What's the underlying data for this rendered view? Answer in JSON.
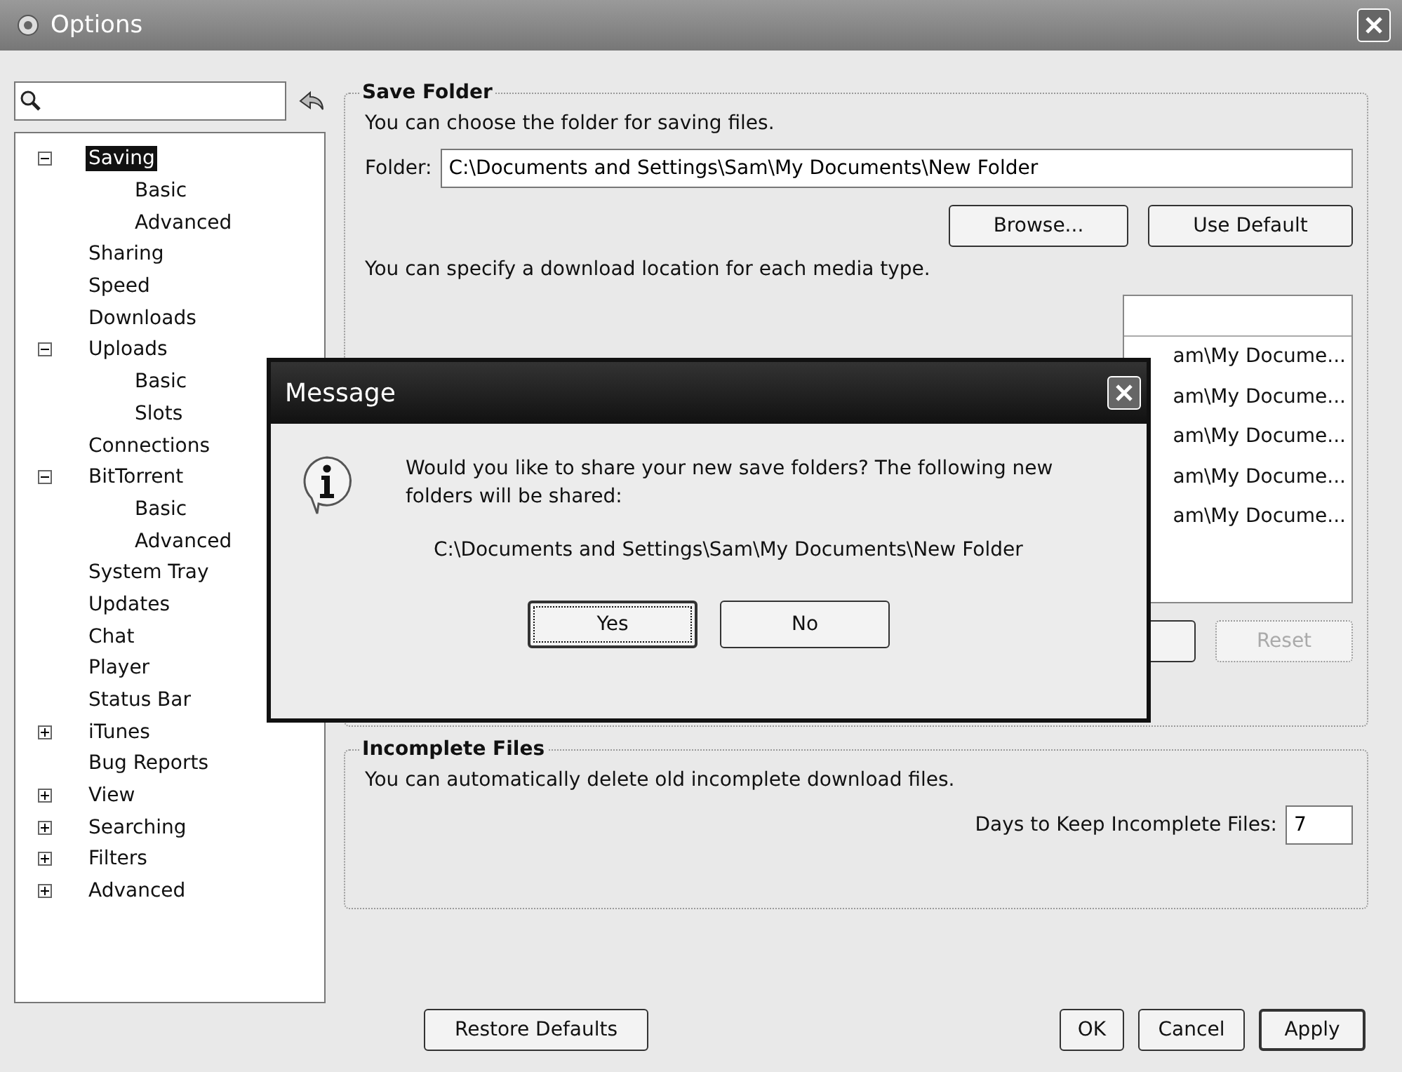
{
  "window": {
    "title": "Options"
  },
  "tree": [
    {
      "label": "Saving",
      "selected": true,
      "expanded": true,
      "children": [
        {
          "label": "Basic",
          "selected": false
        },
        {
          "label": "Advanced",
          "selected": false
        }
      ]
    },
    {
      "label": "Sharing",
      "selected": false
    },
    {
      "label": "Speed",
      "selected": false
    },
    {
      "label": "Downloads",
      "selected": false
    },
    {
      "label": "Uploads",
      "selected": false,
      "expanded": true,
      "children": [
        {
          "label": "Basic",
          "selected": false
        },
        {
          "label": "Slots",
          "selected": false
        }
      ]
    },
    {
      "label": "Connections",
      "selected": false
    },
    {
      "label": "BitTorrent",
      "selected": false,
      "expanded": true,
      "children": [
        {
          "label": "Basic",
          "selected": false
        },
        {
          "label": "Advanced",
          "selected": false
        }
      ]
    },
    {
      "label": "System Tray",
      "selected": false
    },
    {
      "label": "Updates",
      "selected": false
    },
    {
      "label": "Chat",
      "selected": false
    },
    {
      "label": "Player",
      "selected": false
    },
    {
      "label": "Status Bar",
      "selected": false
    },
    {
      "label": "iTunes",
      "selected": false,
      "expanded": false
    },
    {
      "label": "Bug Reports",
      "selected": false
    },
    {
      "label": "View",
      "selected": false,
      "expanded": false
    },
    {
      "label": "Searching",
      "selected": false,
      "expanded": false
    },
    {
      "label": "Filters",
      "selected": false,
      "expanded": false
    },
    {
      "label": "Advanced",
      "selected": false,
      "expanded": false
    }
  ],
  "save_folder": {
    "title": "Save Folder",
    "description": "You can choose the folder for saving files.",
    "folder_label": "Folder:",
    "folder_value": "C:\\Documents and Settings\\Sam\\My Documents\\New Folder",
    "buttons": [
      "Browse...",
      "Use Default"
    ],
    "media_description": "You can specify a download location for each media type.",
    "media_rows": [
      "am\\My Docume...",
      "am\\My Docume...",
      "am\\My Docume...",
      "am\\My Docume...",
      "am\\My Docume..."
    ],
    "reset_button": {
      "label": "Reset",
      "disabled": true
    }
  },
  "incomplete_files": {
    "title": "Incomplete Files",
    "description": "You can automatically delete old incomplete download files.",
    "days_label": "Days to Keep Incomplete Files:",
    "days_value": "7"
  },
  "buttons": [
    {
      "label": "Restore Defaults",
      "default": false
    },
    {
      "label": "OK",
      "default": false
    },
    {
      "label": "Cancel",
      "default": false
    },
    {
      "label": "Apply",
      "default": true
    }
  ],
  "dialog": {
    "title": "Message",
    "message": "Would you like to share your new save folders? The following new folders will be shared:",
    "path": "C:\\Documents and Settings\\Sam\\My Documents\\New Folder",
    "buttons": [
      {
        "label": "Yes",
        "focused": true
      },
      {
        "label": "No",
        "focused": false
      }
    ]
  }
}
